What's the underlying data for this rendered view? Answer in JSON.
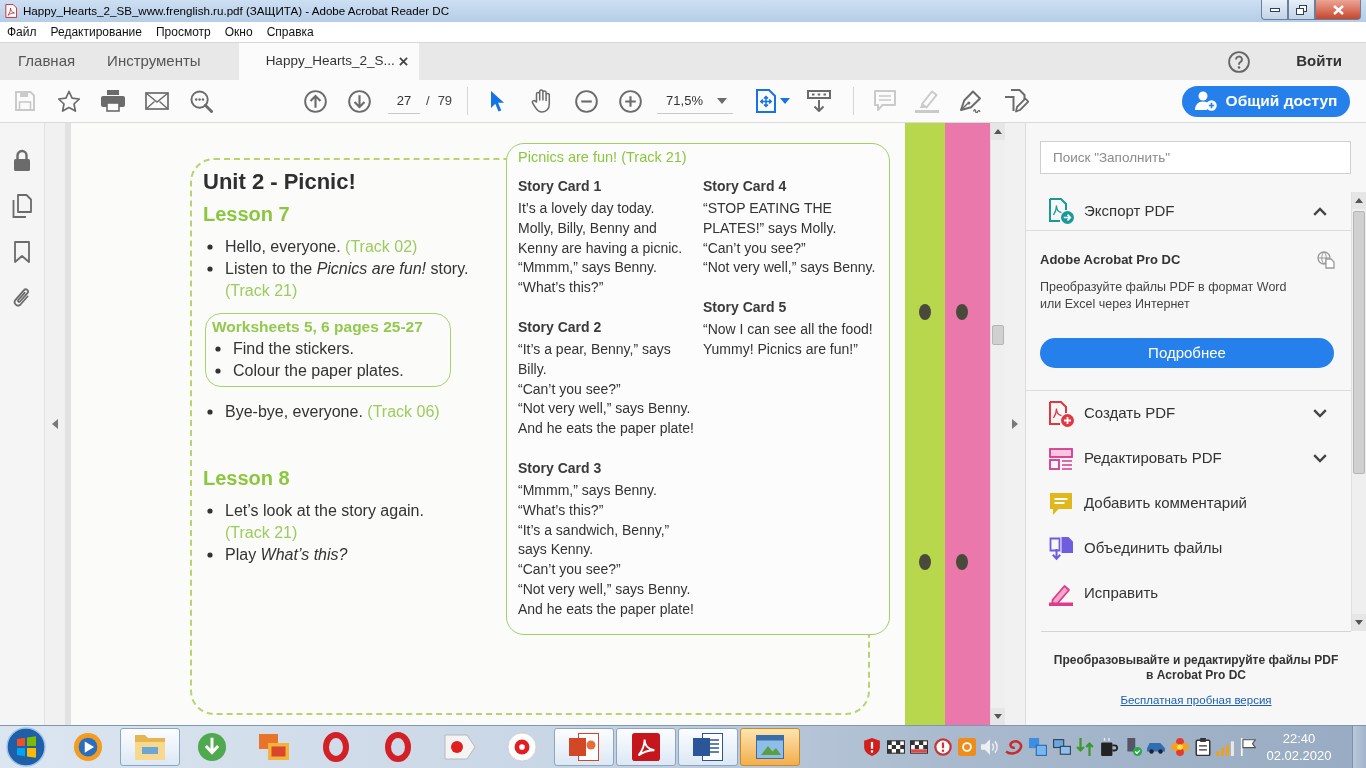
{
  "window": {
    "title": "Happy_Hearts_2_SB_www.frenglish.ru.pdf (ЗАЩИТА) - Adobe Acrobat Reader DC"
  },
  "menu": [
    "Файл",
    "Редактирование",
    "Просмотр",
    "Окно",
    "Справка"
  ],
  "tabs": [
    {
      "label": "Главная",
      "selected": false,
      "closable": false
    },
    {
      "label": "Инструменты",
      "selected": false,
      "closable": false
    },
    {
      "label": "Happy_Hearts_2_S...",
      "selected": true,
      "closable": true
    }
  ],
  "account": {
    "sign_in": "Войти"
  },
  "toolbar": {
    "file_tools": [
      {
        "disabled": true
      },
      {
        "disabled": false
      },
      {
        "disabled": false
      },
      {
        "disabled": false
      },
      {
        "disabled": false
      }
    ],
    "page": {
      "current": "27",
      "separator": "/",
      "total": "79"
    },
    "view_tools": [
      {
        "selected": true
      },
      {
        "selected": false
      }
    ],
    "zoom": {
      "value": "71,5%"
    },
    "annotate_tools": [
      {
        "disabled": true
      },
      {
        "disabled": true
      },
      {
        "disabled": false
      },
      {
        "disabled": false
      }
    ],
    "share_button": "Общий доступ"
  },
  "document": {
    "unit_title": "Unit 2 - Picnic!",
    "lessons": [
      {
        "title": "Lesson 7",
        "items": [
          {
            "kind": "step",
            "text": "Hello, everyone.",
            "track": "(Track 02)"
          },
          {
            "kind": "step",
            "text": "Listen to the *Picnics are fun!* story.",
            "track": "(Track 21)"
          },
          {
            "kind": "worksheet",
            "title": "Worksheets 5, 6 pages 25-27",
            "steps": [
              "Find the stickers.",
              "Colour the paper plates."
            ]
          },
          {
            "kind": "step",
            "text": "Bye-bye, everyone.",
            "track": "(Track 06)"
          }
        ]
      },
      {
        "title": "Lesson 8",
        "items": [
          {
            "kind": "step",
            "text": "Let’s look at the story again.",
            "track": "(Track 21)"
          },
          {
            "kind": "step",
            "text": "Play *What’s this?*"
          }
        ]
      }
    ],
    "story": {
      "title": "Picnics are fun! (Track 21)",
      "columns": [
        {
          "cards": [
            {
              "title": "Story Card 1",
              "lines": [
                "It’s a lovely day today.",
                "Molly, Billy, Benny and",
                "Kenny are having a picnic.",
                "“Mmmm,” says Benny.",
                "“What’s this?”"
              ]
            },
            {
              "title": "Story Card 2",
              "lines": [
                "“It’s a pear, Benny,” says",
                "Billy.",
                "“Can’t you see?”",
                "“Not very well,” says Benny.",
                "And he eats the paper plate!"
              ]
            },
            {
              "title": "Story Card 3",
              "lines": [
                "“Mmmm,” says Benny.",
                "“What’s this?”",
                "“It’s a sandwich, Benny,”",
                "says Kenny.",
                "“Can’t you see?”",
                "“Not very well,” says Benny.",
                "And he eats the paper plate!"
              ]
            }
          ]
        },
        {
          "cards": [
            {
              "title": "Story Card 4",
              "lines": [
                "“STOP EATING THE",
                "PLATES!” says Molly.",
                "“Can’t you see?”",
                "“Not very well,” says Benny."
              ]
            },
            {
              "title": "Story Card 5",
              "lines": [
                "“Now I can see all the food!",
                "Yummy! Picnics are fun!”"
              ]
            }
          ]
        }
      ]
    }
  },
  "tools_pane": {
    "search": {
      "placeholder": "Поиск \"Заполнить\""
    },
    "tools": [
      {
        "kind": "expandable",
        "label": "Экспорт PDF",
        "expanded": true,
        "promo": {
          "title": "Adobe Acrobat Pro DC",
          "text": "Преобразуйте файлы PDF в формат Word или Excel через Интернет",
          "button": "Подробнее"
        }
      },
      {
        "kind": "expandable",
        "label": "Создать PDF",
        "expanded": false
      },
      {
        "kind": "expandable",
        "label": "Редактировать PDF",
        "expanded": false
      },
      {
        "kind": "tool",
        "label": "Добавить комментарий"
      },
      {
        "kind": "tool",
        "label": "Объединить файлы"
      },
      {
        "kind": "tool",
        "label": "Исправить"
      }
    ],
    "footer": {
      "text": "Преобразовывайте и редактируйте файлы PDF в Acrobat Pro DC",
      "link": "Бесплатная пробная версия"
    }
  },
  "taskbar": {
    "apps": [
      {
        "running": false,
        "highlighted": false
      },
      {
        "running": true,
        "highlighted": false
      },
      {
        "running": false,
        "highlighted": false
      },
      {
        "running": false,
        "highlighted": false
      },
      {
        "running": false,
        "highlighted": false
      },
      {
        "running": false,
        "highlighted": false
      },
      {
        "running": false,
        "highlighted": false
      },
      {
        "running": false,
        "highlighted": false
      },
      {
        "running": true,
        "highlighted": false
      },
      {
        "running": true,
        "highlighted": false
      },
      {
        "running": true,
        "highlighted": false
      },
      {
        "running": true,
        "highlighted": true
      }
    ],
    "clock": {
      "time": "22:40",
      "date": "02.02.2020"
    }
  }
}
